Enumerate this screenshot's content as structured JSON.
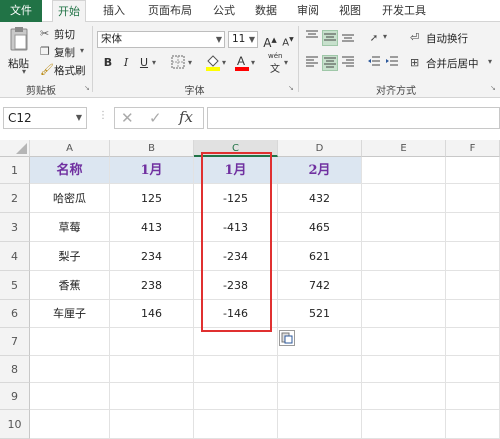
{
  "tabs": [
    "文件",
    "开始",
    "插入",
    "页面布局",
    "公式",
    "数据",
    "审阅",
    "视图",
    "开发工具"
  ],
  "clipboard": {
    "paste": "粘贴",
    "cut": "剪切",
    "copy": "复制",
    "format_painter": "格式刷",
    "group_label": "剪贴板"
  },
  "font": {
    "name": "宋体",
    "size": "11",
    "grow": "A",
    "shrink": "A",
    "bold": "B",
    "italic": "I",
    "underline": "U",
    "pinyin": "wén",
    "group_label": "字体"
  },
  "alignment": {
    "wrap_text": "自动换行",
    "merge_center": "合并后居中",
    "group_label": "对齐方式"
  },
  "formula_bar": {
    "name_box": "C12",
    "fx": "fx",
    "value": ""
  },
  "columns": [
    "A",
    "B",
    "C",
    "D",
    "E",
    "F"
  ],
  "rows": [
    "1",
    "2",
    "3",
    "4",
    "5",
    "6",
    "7",
    "8",
    "9",
    "10"
  ],
  "table": {
    "headers": [
      "名称",
      "1月",
      "1月",
      "2月"
    ],
    "data": [
      [
        "哈密瓜",
        "125",
        "-125",
        "432"
      ],
      [
        "草莓",
        "413",
        "-413",
        "465"
      ],
      [
        "梨子",
        "234",
        "-234",
        "621"
      ],
      [
        "香蕉",
        "238",
        "-238",
        "742"
      ],
      [
        "车厘子",
        "146",
        "-146",
        "521"
      ]
    ]
  },
  "colors": {
    "excel_green": "#217346",
    "header_fill": "#dce6f1",
    "header_text": "#7030a0",
    "highlight_box": "#e03030"
  }
}
